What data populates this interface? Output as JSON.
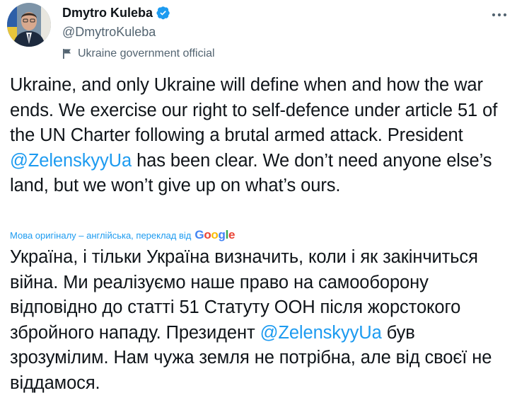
{
  "author": {
    "display_name": "Dmytro Kuleba",
    "handle": "@DmytroKuleba",
    "affiliation": "Ukraine government official"
  },
  "tweet": {
    "text_parts": [
      "Ukraine, and only Ukraine will define when and how the war ends. We exercise our right to self-defence under article 51 of the UN Charter following a brutal armed attack. President ",
      "@ZelenskyyUa",
      " has been clear. We don’t need anyone else’s land, but we won’t give up on what’s ours."
    ]
  },
  "translation": {
    "note": "Мова оригіналу – англійська, переклад від",
    "provider_letters": [
      "G",
      "o",
      "o",
      "g",
      "l",
      "e"
    ],
    "provider_colors": [
      "#4285F4",
      "#EA4335",
      "#FBBC05",
      "#4285F4",
      "#34A853",
      "#EA4335"
    ],
    "text_parts": [
      "Україна, і тільки Україна визначить, коли і як закінчиться війна. Ми реалізуємо наше право на самооборону відповідно до статті 51 Статуту ООН після жорстокого збройного нападу. Президент ",
      "@ZelenskyyUa",
      " був зрозумілим. Нам чужа земля не потрібна, але від своєї не віддамося."
    ]
  },
  "colors": {
    "link": "#1d9bf0",
    "verified": "#1d9bf0",
    "secondary_text": "#536471"
  },
  "icons": {
    "verified": "verified-badge-icon",
    "more": "more-horizontal-icon",
    "affiliation": "flag-icon"
  }
}
